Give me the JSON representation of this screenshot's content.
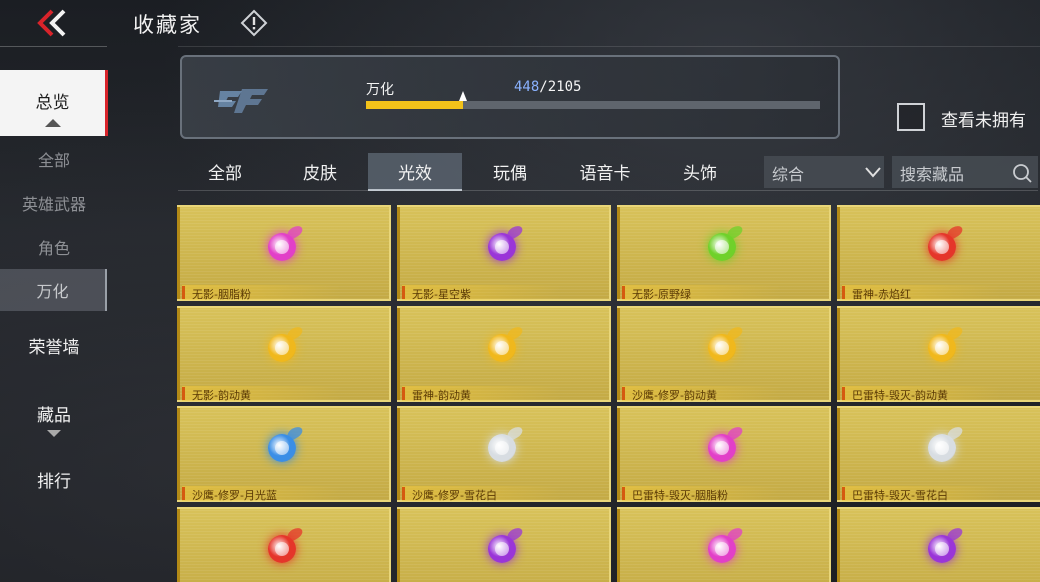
{
  "header": {
    "title": "收藏家"
  },
  "sidebar": {
    "main": "总览",
    "sub_items": [
      "全部",
      "英雄武器",
      "角色",
      "万化"
    ],
    "active_sub": "万化",
    "items": [
      "荣誉墙",
      "藏品",
      "排行"
    ]
  },
  "banner": {
    "label": "万化",
    "current": "448",
    "total": "/2105",
    "progress": 0.213
  },
  "filter": {
    "unowned_label": "查看未拥有",
    "unowned_checked": false
  },
  "tabs": [
    "全部",
    "皮肤",
    "光效",
    "玩偶",
    "语音卡",
    "头饰"
  ],
  "active_tab": "光效",
  "sort": {
    "value": "综合"
  },
  "search": {
    "placeholder": "搜索藏品"
  },
  "colors": {
    "accent_red": "#d8232a",
    "progress": "#f2c21a",
    "card_gold": "#d4bd55"
  },
  "cards": [
    {
      "name": "无影-胭脂粉",
      "color": "#e23fc8"
    },
    {
      "name": "无影-星空紫",
      "color": "#9a35d8"
    },
    {
      "name": "无影-原野绿",
      "color": "#6fd12a"
    },
    {
      "name": "雷神-赤焰红",
      "color": "#e5352a"
    },
    {
      "name": "无影-韵动黄",
      "color": "#f0b81c"
    },
    {
      "name": "雷神-韵动黄",
      "color": "#f0b81c"
    },
    {
      "name": "沙鹰-修罗-韵动黄",
      "color": "#f0b81c"
    },
    {
      "name": "巴雷特-毁灭-韵动黄",
      "color": "#f0b81c"
    },
    {
      "name": "沙鹰-修罗-月光蓝",
      "color": "#3a8ee6"
    },
    {
      "name": "沙鹰-修罗-雪花白",
      "color": "#d8dde2"
    },
    {
      "name": "巴雷特-毁灭-胭脂粉",
      "color": "#e23fc8"
    },
    {
      "name": "巴雷特-毁灭-雪花白",
      "color": "#d8dde2"
    },
    {
      "name": "",
      "color": "#e5352a"
    },
    {
      "name": "",
      "color": "#9a35d8"
    },
    {
      "name": "",
      "color": "#e23fc8"
    },
    {
      "name": "",
      "color": "#9a35d8"
    }
  ]
}
